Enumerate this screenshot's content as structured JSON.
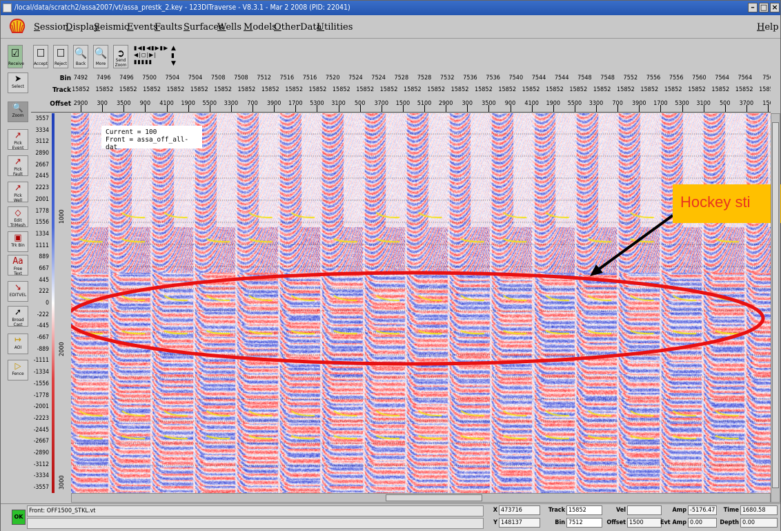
{
  "window": {
    "title": "/local/data/scratch2/assa2007/vt/assa_prestk_2.key - 123DITraverse - V8.3.1 - Mar 2 2008 (PID: 22041)"
  },
  "menu": {
    "items": [
      "Session",
      "Display",
      "Seismic",
      "Events",
      "Faults",
      "Surfaces",
      "Wells",
      "Models",
      "OtherData",
      "Utilities"
    ],
    "help": "Help"
  },
  "toolbar": {
    "receive": "Receive",
    "accept": "Accept",
    "reject": "Reject",
    "back": "Back",
    "more": "More",
    "send_zoom_1": "Send",
    "send_zoom_2": "Zoom"
  },
  "left_tools": [
    {
      "name": "select-tool",
      "label1": "Select",
      "label2": ""
    },
    {
      "name": "zoom-tool",
      "label1": "Zoom",
      "label2": ""
    },
    {
      "name": "pick-event-tool",
      "label1": "Pick",
      "label2": "Event"
    },
    {
      "name": "pick-fault-tool",
      "label1": "Pick",
      "label2": "Fault"
    },
    {
      "name": "pick-well-tool",
      "label1": "Pick",
      "label2": "Well"
    },
    {
      "name": "edit-trimesh-tool",
      "label1": "Edit",
      "label2": "TriMesh"
    },
    {
      "name": "trk-bin-tool",
      "label1": "Trk Bin",
      "label2": ""
    },
    {
      "name": "free-text-tool",
      "label1": "Free",
      "label2": "Text"
    },
    {
      "name": "edit-vel-tool",
      "label1": "EDITVEL",
      "label2": ""
    },
    {
      "name": "broadcast-tool",
      "label1": "Broad",
      "label2": "Cast"
    },
    {
      "name": "aoi-tool",
      "label1": "AOI",
      "label2": ""
    },
    {
      "name": "fence-tool",
      "label1": "Fence",
      "label2": ""
    }
  ],
  "header": {
    "labels": {
      "bin": "Bin",
      "track": "Track",
      "offset": "Offset"
    },
    "bin": [
      "7492",
      "7496",
      "7496",
      "7500",
      "7504",
      "7504",
      "7508",
      "7508",
      "7512",
      "7516",
      "7516",
      "7520",
      "7524",
      "7524",
      "7528",
      "7528",
      "7532",
      "7536",
      "7536",
      "7540",
      "7544",
      "7544",
      "7548",
      "7548",
      "7552",
      "7556",
      "7556",
      "7560",
      "7564",
      "7564",
      "756"
    ],
    "track": [
      "15852",
      "15852",
      "15852",
      "15852",
      "15852",
      "15852",
      "15852",
      "15852",
      "15852",
      "15852",
      "15852",
      "15852",
      "15852",
      "15852",
      "15852",
      "15852",
      "15852",
      "15852",
      "15852",
      "15852",
      "15852",
      "15852",
      "15852",
      "15852",
      "15852",
      "15852",
      "15852",
      "15852",
      "15852",
      "15852"
    ],
    "offset": [
      "2900",
      "300",
      "3500",
      "900",
      "4100",
      "1900",
      "5500",
      "3300",
      "700",
      "3900",
      "1700",
      "5300",
      "3100",
      "500",
      "3700",
      "1500",
      "5100",
      "2900",
      "300",
      "3500",
      "900",
      "4100",
      "1900",
      "5500",
      "3300",
      "700",
      "3900",
      "1700",
      "5300",
      "3100",
      "500",
      "3700",
      "150"
    ]
  },
  "amplitude_scale": [
    "3557",
    "3334",
    "3112",
    "2890",
    "2667",
    "2445",
    "2223",
    "2001",
    "1778",
    "1556",
    "1334",
    "1111",
    "889",
    "667",
    "445",
    "222",
    "0",
    "-222",
    "-445",
    "-667",
    "-889",
    "-1111",
    "-1334",
    "-1556",
    "-1778",
    "-2001",
    "-2223",
    "-2445",
    "-2667",
    "-2890",
    "-3112",
    "-3334",
    "-3557"
  ],
  "time_axis": [
    "1000",
    "2000",
    "3000"
  ],
  "overlay": {
    "current": "Current = 100",
    "front": "Front = assa_off_all-dat"
  },
  "annotation": {
    "label": "Hockey sti"
  },
  "status": {
    "ok": "OK",
    "front_message": "Front: OFF1500_STKL.vt",
    "x_label": "X",
    "x_value": "473716",
    "y_label": "Y",
    "y_value": "148137",
    "track_label": "Track",
    "track_value": "15852",
    "bin_label": "Bin",
    "bin_value": "7512",
    "vel_label": "Vel",
    "vel_value": "",
    "offset_label": "Offset",
    "offset_value": "1500",
    "amp_label": "Amp",
    "amp_value": "-5176.47",
    "evtamp_label": "Evt Amp",
    "evtamp_value": "0.00",
    "time_label": "Time",
    "time_value": "1680.58",
    "depth_label": "Depth",
    "depth_value": "0.00"
  },
  "colors": {
    "title_bar": "#2a5fbf",
    "annotation_box": "#ffc000",
    "annotation_text": "#e8351e",
    "ellipse": "#e81010",
    "ok_button": "#2bc02b"
  }
}
